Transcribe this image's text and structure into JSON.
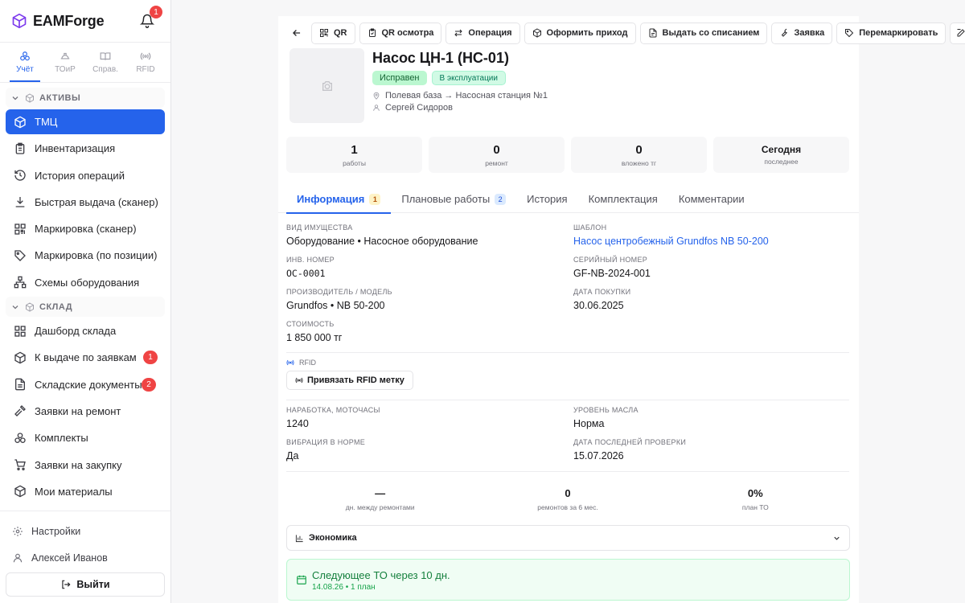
{
  "app": {
    "name": "EAMForge",
    "notifications": "1"
  },
  "modules": [
    {
      "label": "Учёт",
      "icon": "boxes-icon"
    },
    {
      "label": "ТОиР",
      "icon": "helmet-icon"
    },
    {
      "label": "Справ.",
      "icon": "book-icon"
    },
    {
      "label": "RFID",
      "icon": "radio-icon"
    }
  ],
  "sections": {
    "assets": "АКТИВЫ",
    "warehouse": "СКЛАД"
  },
  "nav": {
    "assets": [
      "ТМЦ",
      "Инвентаризация",
      "История операций",
      "Быстрая выдача (сканер)",
      "Маркировка (сканер)",
      "Маркировка (по позиции)",
      "Схемы оборудования"
    ],
    "warehouse": [
      "Дашборд склада",
      "К выдаче по заявкам",
      "Складские документы",
      "Заявки на ремонт",
      "Комплекты",
      "Заявки на закупку",
      "Мои материалы"
    ],
    "counts": {
      "issue": "1",
      "docs": "2"
    }
  },
  "footer": {
    "settings": "Настройки",
    "user": "Алексей Иванов",
    "logout": "Выйти"
  },
  "toolbar": {
    "qr": "QR",
    "qr_inspect": "QR осмотра",
    "operation": "Операция",
    "receipt": "Оформить приход",
    "writeoff": "Выдать со списанием",
    "request": "Заявка",
    "remark": "Перемаркировать"
  },
  "asset": {
    "title": "Насос ЦН-1 (НС-01)",
    "status": "Исправен",
    "state": "В эксплуатации",
    "location": "Полевая база → Насосная станция №1",
    "owner": "Сергей Сидоров"
  },
  "stats": [
    {
      "value": "1",
      "label": "работы"
    },
    {
      "value": "0",
      "label": "ремонт"
    },
    {
      "value": "0",
      "label": "вложено тг"
    },
    {
      "value": "Сегодня",
      "label": "последнее"
    }
  ],
  "tabs": [
    {
      "label": "Информация",
      "count": "1"
    },
    {
      "label": "Плановые работы",
      "count": "2"
    },
    {
      "label": "История"
    },
    {
      "label": "Комплектация"
    },
    {
      "label": "Комментарии"
    }
  ],
  "info": {
    "kind_k": "ВИД ИМУЩЕСТВА",
    "kind_v": "Оборудование • Насосное оборудование",
    "template_k": "ШАБЛОН",
    "template_v": "Насос центробежный Grundfos NB 50-200",
    "inv_k": "ИНВ. НОМЕР",
    "inv_v": "ОС-0001",
    "serial_k": "СЕРИЙНЫЙ НОМЕР",
    "serial_v": "GF-NB-2024-001",
    "maker_k": "ПРОИЗВОДИТЕЛЬ / МОДЕЛЬ",
    "maker_v": "Grundfos • NB 50-200",
    "buy_k": "ДАТА ПОКУПКИ",
    "buy_v": "30.06.2025",
    "cost_k": "СТОИМОСТЬ",
    "cost_v": "1 850 000 тг"
  },
  "rfid": {
    "label": "RFID",
    "button": "Привязать RFID метку"
  },
  "params": {
    "hours_k": "НАРАБОТКА, МОТОЧАСЫ",
    "hours_v": "1240",
    "oil_k": "УРОВЕНЬ МАСЛА",
    "oil_v": "Норма",
    "vib_k": "ВИБРАЦИЯ В НОРМЕ",
    "vib_v": "Да",
    "check_k": "ДАТА ПОСЛЕДНЕЙ ПРОВЕРКИ",
    "check_v": "15.07.2026"
  },
  "kpis": [
    {
      "value": "—",
      "label": "дн. между ремонтами"
    },
    {
      "value": "0",
      "label": "ремонтов за 6 мес."
    },
    {
      "value": "0%",
      "label": "план ТО"
    }
  ],
  "economics": "Экономика",
  "next_maintenance": {
    "title": "Следующее ТО через 10 дн.",
    "sub": "14.08.26 • 1 план"
  }
}
